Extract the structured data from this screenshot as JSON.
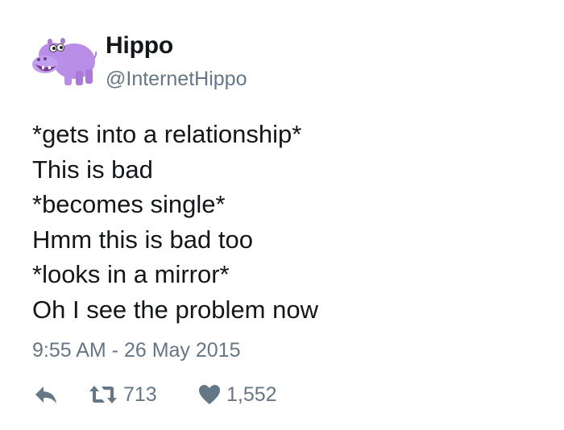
{
  "user": {
    "display_name": "Hippo",
    "handle": "@InternetHippo",
    "avatar_icon": "hippo-avatar-icon"
  },
  "tweet": {
    "lines": [
      "*gets into a relationship*",
      "This is bad",
      "*becomes single*",
      "Hmm this is bad too",
      "*looks in a mirror*",
      "Oh I see the problem now"
    ],
    "timestamp": "9:55 AM - 26 May 2015"
  },
  "actions": {
    "reply_icon": "reply-icon",
    "retweet_icon": "retweet-icon",
    "retweet_count": "713",
    "like_icon": "heart-icon",
    "like_count": "1,552"
  },
  "colors": {
    "text": "#14171a",
    "secondary": "#657786",
    "avatar_purple": "#b98ee6"
  }
}
